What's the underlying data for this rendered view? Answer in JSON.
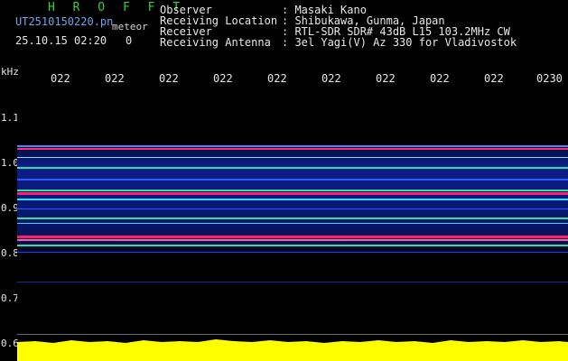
{
  "header": {
    "app_title": "H R O F F T",
    "file_name": "UT2510150220.pn",
    "meteor_label": "meteor",
    "date_time": "25.10.15 02:20",
    "count": "0",
    "fields": [
      {
        "label": "Observer",
        "value": ": Masaki Kano"
      },
      {
        "label": "Receiving Location",
        "value": ": Shibukawa, Gunma, Japan"
      },
      {
        "label": "Receiver",
        "value": ": RTL-SDR SDR# 43dB L15 103.2MHz CW"
      },
      {
        "label": "Receiving Antenna",
        "value": ": 3el Yagi(V) Az 330 for Vladivostok"
      }
    ]
  },
  "time_axis": {
    "labels": [
      "022",
      "022",
      "022",
      "022",
      "022",
      "022",
      "022",
      "022",
      "022",
      "0230"
    ]
  },
  "freq_axis": {
    "unit": "kHz",
    "labels": [
      "1.1",
      "1.0",
      "0.9",
      "0.8",
      "0.7",
      "0.6"
    ]
  },
  "colors": {
    "background": "#000000",
    "signal_strip": "#ffff00",
    "divider": "#6a6a6a",
    "band_strong": "#ff1f6a",
    "band_mid": "#2fe0a0",
    "band_weak": "#1a3dff"
  }
}
